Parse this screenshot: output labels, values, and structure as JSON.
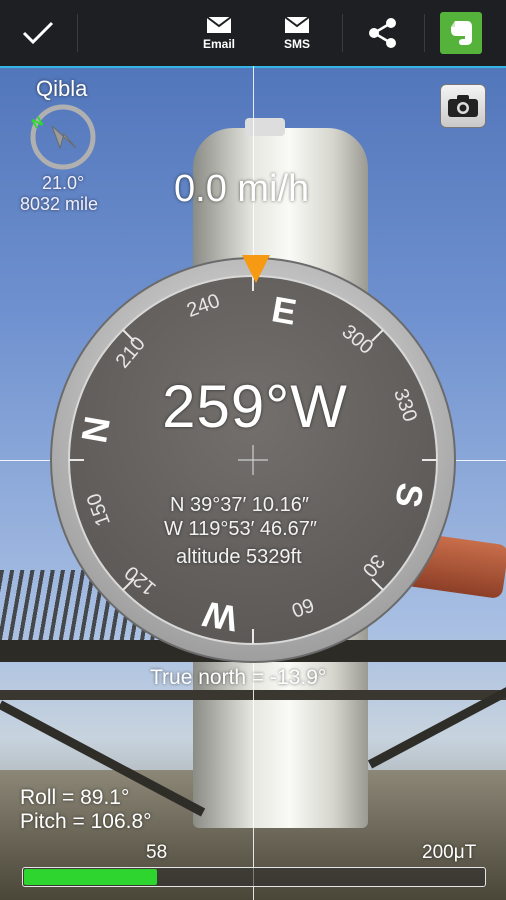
{
  "toolbar": {
    "done_icon": "check-icon",
    "email_label": "Email",
    "sms_label": "SMS",
    "share_icon": "share-icon",
    "evernote_icon": "evernote-icon"
  },
  "qibla": {
    "title": "Qibla",
    "angle": "21.0°",
    "distance": "8032 mile",
    "north_marker": "N"
  },
  "speed": "0.0 mi/h",
  "camera_button_icon": "camera-icon",
  "compass": {
    "heading": "259°W",
    "cardinals": {
      "north": "N",
      "east": "E",
      "south": "S",
      "west": "W"
    },
    "ticks": [
      "240",
      "300",
      "330",
      "210",
      "150",
      "120",
      "60",
      "30"
    ],
    "latitude": "N 39°37′ 10.16″",
    "longitude": "W 119°53′ 46.67″",
    "altitude": "altitude 5329ft",
    "marker_color": "#f59a12"
  },
  "true_north": "True north = -13.9°",
  "orientation": {
    "roll": "Roll   = 89.1°",
    "pitch": "Pitch = 106.8°"
  },
  "magnetic_field": {
    "value": "58",
    "max_label": "200μT",
    "level_fraction": 0.29,
    "bar_color": "#2fd52f"
  }
}
